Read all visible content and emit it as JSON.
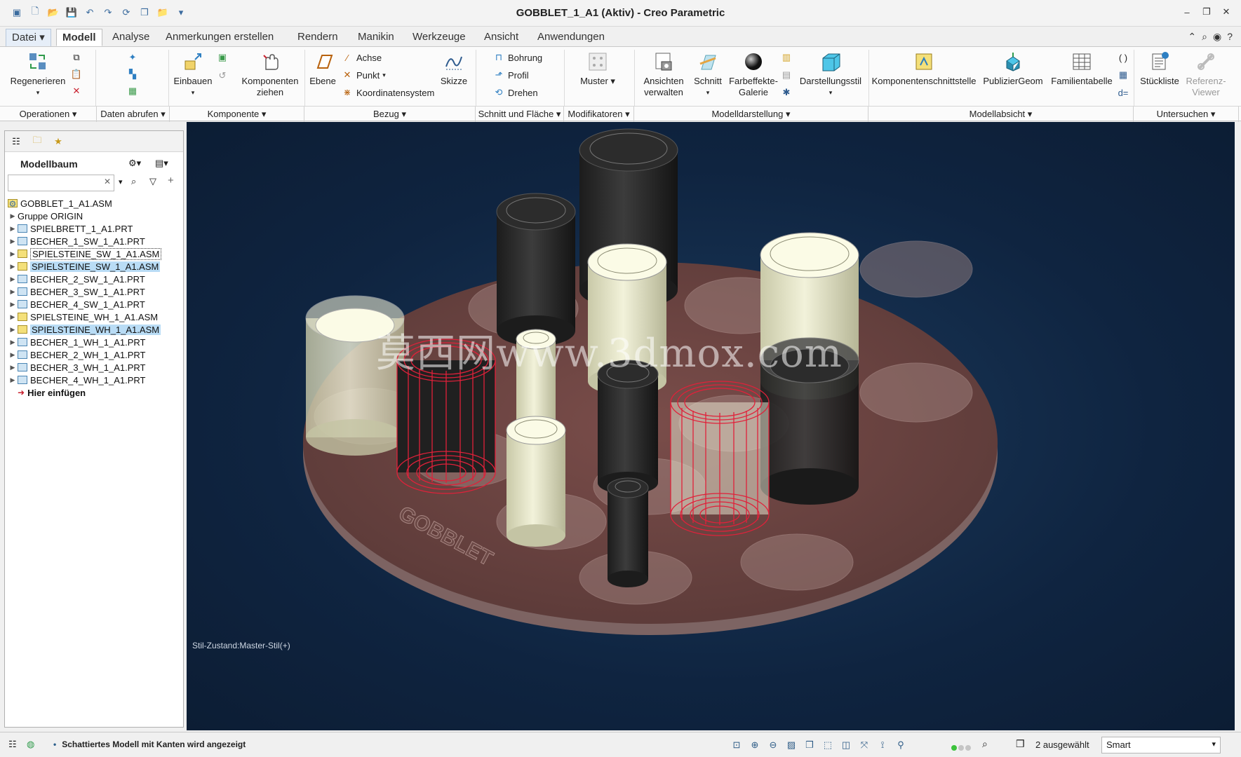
{
  "window": {
    "title": "GOBBLET_1_A1 (Aktiv) - Creo Parametric"
  },
  "tabs": [
    "Datei",
    "Modell",
    "Analyse",
    "Anmerkungen erstellen",
    "Rendern",
    "Manikin",
    "Werkzeuge",
    "Ansicht",
    "Anwendungen"
  ],
  "ribbon": {
    "regenerate": "Regenerieren",
    "einbauen": "Einbauen",
    "komponenten_ziehen": "Komponenten\nziehen",
    "ebene": "Ebene",
    "achse": "Achse",
    "punkt": "Punkt",
    "koordinatensystem": "Koordinatensystem",
    "skizze": "Skizze",
    "bohrung": "Bohrung",
    "profil": "Profil",
    "drehen": "Drehen",
    "muster": "Muster",
    "ansichten_verwalten": "Ansichten\nverwalten",
    "schnitt": "Schnitt",
    "farbeffekte_galerie": "Farbeffekte-\nGalerie",
    "darstellungsstil": "Darstellungsstil",
    "komponentenschnittstelle": "Komponentenschnittstelle",
    "publiziergeom": "PublizierGeom",
    "familientabelle": "Familientabelle",
    "stueckliste": "Stückliste",
    "referenz_viewer": "Referenz-\nViewer",
    "groups": [
      "Operationen",
      "Daten abrufen",
      "Komponente",
      "Bezug",
      "Schnitt und Fläche",
      "Modifikatoren",
      "Modelldarstellung",
      "Modellabsicht",
      "Untersuchen"
    ]
  },
  "model_tree": {
    "title": "Modellbaum",
    "search_placeholder": "",
    "items": [
      {
        "label": "GOBBLET_1_A1.ASM",
        "type": "asm",
        "root": true
      },
      {
        "label": "Gruppe ORIGIN",
        "type": "grp"
      },
      {
        "label": "SPIELBRETT_1_A1.PRT",
        "type": "prt"
      },
      {
        "label": "BECHER_1_SW_1_A1.PRT",
        "type": "prt"
      },
      {
        "label": "SPIELSTEINE_SW_1_A1.ASM",
        "type": "asm",
        "state": "outlined"
      },
      {
        "label": "SPIELSTEINE_SW_1_A1.ASM",
        "type": "asm",
        "state": "hl"
      },
      {
        "label": "BECHER_2_SW_1_A1.PRT",
        "type": "prt"
      },
      {
        "label": "BECHER_3_SW_1_A1.PRT",
        "type": "prt"
      },
      {
        "label": "BECHER_4_SW_1_A1.PRT",
        "type": "prt"
      },
      {
        "label": "SPIELSTEINE_WH_1_A1.ASM",
        "type": "asm"
      },
      {
        "label": "SPIELSTEINE_WH_1_A1.ASM",
        "type": "asm",
        "state": "hl"
      },
      {
        "label": "BECHER_1_WH_1_A1.PRT",
        "type": "prt"
      },
      {
        "label": "BECHER_2_WH_1_A1.PRT",
        "type": "prt"
      },
      {
        "label": "BECHER_3_WH_1_A1.PRT",
        "type": "prt"
      },
      {
        "label": "BECHER_4_WH_1_A1.PRT",
        "type": "prt"
      },
      {
        "label": "Hier einfügen",
        "type": "insert"
      }
    ]
  },
  "viewport": {
    "style_state": "Stil-Zustand:Master-Stil(+)",
    "board_label": "GOBBLET",
    "watermark": "莫西网www.3dmox.com"
  },
  "status": {
    "message": "Schattiertes Modell mit Kanten wird angezeigt",
    "selected": "2 ausgewählt",
    "filter": "Smart"
  }
}
